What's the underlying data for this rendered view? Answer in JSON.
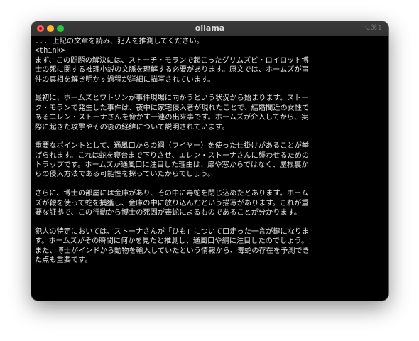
{
  "window": {
    "title": "ollama",
    "shortcut": "⌥⌘1"
  },
  "terminal": {
    "prompt_line": "... 上記の文章を読み、犯人を推測してください。",
    "think_tag": "<think>",
    "paragraphs": [
      [
        "まず、この問題の解決には、ストーチ・モランで起こったグリムズビ・ロイロット博",
        "士の死に関する推理小説の文脈を理解する必要があります。原文では、ホームズが事",
        "件の真相を解き明かす過程が詳細に描写されています。"
      ],
      [
        "最初に、ホームズとワトソンが事件現場に向かうという状況から始まります。ストー",
        "ク・モランで発生した事件は、夜中に家宅侵入者が現れたことで、結婚間近の女性で",
        "あるエレン・ストーナさんを脅かす一連の出来事です。ホームズが介入してから、実",
        "際に起きた攻撃やその後の経緯について説明されています。"
      ],
      [
        "重要なポイントとして、通風口からの綱（ワイヤー）を使った仕掛けがあることが挙",
        "げられます。これは蛇を寝台まで下りさせ、エレン・ストーナさんに襲わせるための",
        "トラップです。ホームズが通風口に注目した理由は、扉や窓からではなく、屋根裏か",
        "らの侵入方法である可能性を探っていたからでしょう。"
      ],
      [
        "さらに、博士の部屋には金庫があり、その中に毒蛇を閉じ込めたとあります。ホーム",
        "ズが鞭を使って蛇を捕獲し、金庫の中に放り込んだという描写があります。これが重",
        "要な証拠で、この行動から博士の死因が毒蛇によるものであることが分かります。"
      ],
      [
        "犯人の特定においては、ストーナさんが「ひも」について口走った一言が鍵になりま",
        "す。ホームズがその瞬間に何かを見たと推測し、通風口や綱に注目したのでしょう。",
        "また、博士がインドから動物を輸入していたという情報から、毒蛇の存在を予測でき",
        "た点も重要です。"
      ]
    ]
  }
}
